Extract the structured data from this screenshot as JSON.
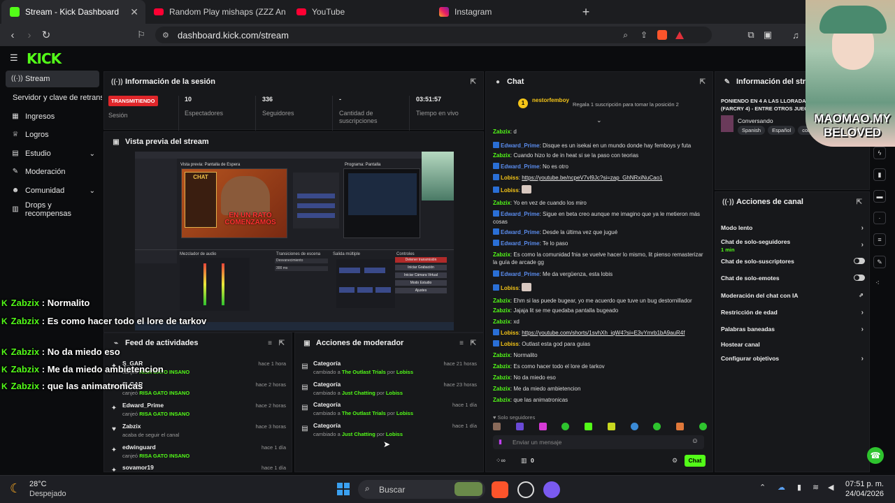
{
  "browser": {
    "tabs": [
      {
        "title": "Stream - Kick Dashboard",
        "active": true
      },
      {
        "title": "Random Play mishaps (ZZZ Animatio"
      },
      {
        "title": "YouTube"
      },
      {
        "title": "Instagram"
      }
    ],
    "url": "dashboard.kick.com/stream"
  },
  "brand": {
    "logo": "KICK",
    "accent": "#53fc18"
  },
  "sidebar": {
    "items": [
      {
        "label": "Stream",
        "icon": "signal-icon"
      },
      {
        "label": "Servidor y clave de retransmi",
        "icon": ""
      },
      {
        "label": "Ingresos",
        "icon": "revenue-icon"
      },
      {
        "label": "Logros",
        "icon": "trophy-icon"
      },
      {
        "label": "Estudio",
        "icon": "studio-icon"
      },
      {
        "label": "Moderación",
        "icon": "wrench-icon"
      },
      {
        "label": "Comunidad",
        "icon": "community-icon"
      },
      {
        "label": "Drops y recompensas",
        "icon": "gift-icon"
      }
    ]
  },
  "session": {
    "title": "Información de la sesión",
    "live_badge": "TRANSMITIENDO",
    "stats": [
      {
        "value": "",
        "label": "Sesión"
      },
      {
        "value": "10",
        "label": "Espectadores"
      },
      {
        "value": "336",
        "label": "Seguidores"
      },
      {
        "value": "-",
        "label": "Cantidad de suscripciones"
      },
      {
        "value": "03:51:57",
        "label": "Tiempo en vivo"
      }
    ]
  },
  "preview": {
    "title": "Vista previa del stream",
    "inner_left": "Vista previa: Pantalla de Espera",
    "inner_right": "Programa: Pantalla",
    "chat_label": "CHAT",
    "banner_text": "EN UN RATO COMENZAMOS",
    "mixer_label": "Mezclador de audio",
    "transitions_label": "Transiciones de escena",
    "exit_label": "Salida múltiple",
    "controls_label": "Controles",
    "controls": [
      "Detener transmisión",
      "Iniciar Grabación",
      "Iniciar Cámara Virtual",
      "Modo Estudio",
      "Ajustes"
    ],
    "transition_value": "Desvanecimiento",
    "duration_value": "300 ms"
  },
  "feed": {
    "title": "Feed de actividades",
    "items": [
      {
        "name": "S_GAR",
        "sub": "canjeó",
        "reward": "RISA GATO INSANO",
        "time": "hace 1 hora"
      },
      {
        "name": "S_GAR",
        "sub": "canjeó",
        "reward": "RISA GATO INSANO",
        "time": "hace 2 horas"
      },
      {
        "name": "Edward_Prime",
        "sub": "canjeó",
        "reward": "RISA GATO INSANO",
        "time": "hace 2 horas"
      },
      {
        "name": "Zabzix",
        "sub": "acaba de seguir el canal",
        "reward": "",
        "time": "hace 3 horas"
      },
      {
        "name": "edwinguard",
        "sub": "canjeó",
        "reward": "RISA GATO INSANO",
        "time": "hace 1 día"
      },
      {
        "name": "sovamor19",
        "sub": "",
        "reward": "",
        "time": "hace 1 día"
      }
    ]
  },
  "modactions": {
    "title": "Acciones de moderador",
    "items": [
      {
        "name": "Categoría",
        "pre": "cambiado a",
        "val": "The Outlast Trials",
        "by": "por",
        "who": "Lobiss",
        "time": "hace 21 horas"
      },
      {
        "name": "Categoría",
        "pre": "cambiado a",
        "val": "Just Chatting",
        "by": "por",
        "who": "Lobiss",
        "time": "hace 23 horas"
      },
      {
        "name": "Categoría",
        "pre": "cambiado a",
        "val": "The Outlast Trials",
        "by": "por",
        "who": "Lobiss",
        "time": "hace 1 día"
      },
      {
        "name": "Categoría",
        "pre": "cambiado a",
        "val": "Just Chatting",
        "by": "por",
        "who": "Lobiss",
        "time": "hace 1 día"
      }
    ]
  },
  "chat": {
    "title": "Chat",
    "pinned_user": "nestorfemboy",
    "pinned_count": "1",
    "gift_text": "Regala 1 suscripción para tomar la posición 2",
    "messages": [
      {
        "user": "Zabzix",
        "text": "d",
        "color": "#53fc18",
        "badge": false
      },
      {
        "user": "Edward_Prime",
        "text": "Disque es un isekai en un mundo donde hay femboys y futa",
        "color": "#5b8def",
        "badge": true
      },
      {
        "user": "Zabzix",
        "text": "Cuando hizo lo de in heat si se la paso con teorias",
        "color": "#53fc18",
        "badge": false
      },
      {
        "user": "Edward_Prime",
        "text": "No es otro",
        "color": "#5b8def",
        "badge": true
      },
      {
        "user": "Lobiss",
        "text": "https://youtube.be/ncpeV7vI9Jc?si=zap_GhNRxiNuCao1",
        "color": "#f5c518",
        "badge": true,
        "link": true
      },
      {
        "user": "Lobiss",
        "text": "",
        "color": "#f5c518",
        "badge": true,
        "emote": true
      },
      {
        "user": "Zabzix",
        "text": "Yo en vez de cuando los miro",
        "color": "#53fc18",
        "badge": false
      },
      {
        "user": "Edward_Prime",
        "text": "Sigue en beta creo aunque me imagino que ya le metieron más cosas",
        "color": "#5b8def",
        "badge": true
      },
      {
        "user": "Edward_Prime",
        "text": "Desde la última vez que jugué",
        "color": "#5b8def",
        "badge": true
      },
      {
        "user": "Edward_Prime",
        "text": "Te lo paso",
        "color": "#5b8def",
        "badge": true
      },
      {
        "user": "Zabzix",
        "text": "Es como la comunidad fnia se vuelve hacer lo mismo, lit pienso remasterizar la guía de arcade gg",
        "color": "#53fc18",
        "badge": false
      },
      {
        "user": "Edward_Prime",
        "text": "Me da vergüenza, esta lobis",
        "color": "#5b8def",
        "badge": true
      },
      {
        "user": "Lobiss",
        "text": "",
        "color": "#f5c518",
        "badge": true,
        "emote": true
      },
      {
        "user": "Zabzix",
        "text": "Ehm si las puede bugear, yo me acuerdo que tuve un bug destornillador",
        "color": "#53fc18",
        "badge": false
      },
      {
        "user": "Zabzix",
        "text": "Jajaja lit se me quedaba pantalla bugeado",
        "color": "#53fc18",
        "badge": false
      },
      {
        "user": "Zabzix",
        "text": "xd",
        "color": "#53fc18",
        "badge": false
      },
      {
        "user": "Lobiss",
        "text": "https://youtube.com/shorts/1svhXh_iqW4?si=E3vYmrb1bA9auR4f",
        "color": "#f5c518",
        "badge": true,
        "link": true
      },
      {
        "user": "Lobiss",
        "text": "Outlast esta god para guias",
        "color": "#f5c518",
        "badge": true
      },
      {
        "user": "Zabzix",
        "text": "Normalito",
        "color": "#53fc18",
        "badge": false
      },
      {
        "user": "Zabzix",
        "text": "Es como hacer todo el lore de tarkov",
        "color": "#53fc18",
        "badge": false
      },
      {
        "user": "Zabzix",
        "text": "No da miedo eso",
        "color": "#53fc18",
        "badge": false
      },
      {
        "user": "Zabzix",
        "text": "Me da miedo ambietencion",
        "color": "#53fc18",
        "badge": false
      },
      {
        "user": "Zabzix",
        "text": "que las animatronicas",
        "color": "#53fc18",
        "badge": false
      }
    ],
    "followers_only": "Solo seguidores",
    "input_placeholder": "Enviar un mensaje",
    "count": "0",
    "send_label": "Chat"
  },
  "info": {
    "title": "Información del stream",
    "stream_title": "PONIENDO EN 4 A LAS LLORADAS (FARCRY 4) - ENTRE OTROS JUEGOS",
    "category": "Conversando",
    "tags": [
      "Spanish",
      "Español",
      "conversando"
    ]
  },
  "channel_actions": {
    "title": "Acciones de canal",
    "items": [
      {
        "label": "Modo lento",
        "sub": "",
        "kind": "arrow"
      },
      {
        "label": "Chat de solo-seguidores",
        "sub": "1 min",
        "kind": "arrow"
      },
      {
        "label": "Chat de solo-suscriptores",
        "sub": "",
        "kind": "toggle"
      },
      {
        "label": "Chat de solo-emotes",
        "sub": "",
        "kind": "toggle"
      },
      {
        "label": "Moderación del chat con IA",
        "sub": "",
        "kind": "ext"
      },
      {
        "label": "Restricción de edad",
        "sub": "",
        "kind": "arrow"
      },
      {
        "label": "Palabras baneadas",
        "sub": "",
        "kind": "arrow"
      },
      {
        "label": "Hostear canal",
        "sub": "",
        "kind": "none"
      },
      {
        "label": "Configurar objetivos",
        "sub": "",
        "kind": "arrow"
      }
    ]
  },
  "overlay": {
    "watermark": "MAOMAO.MY BELOVED",
    "lines": [
      {
        "user": "Zabzix",
        "text": "Normalito"
      },
      {
        "user": "Zabzix",
        "text": "Es como hacer todo el lore de tarkov"
      },
      {
        "user": "Zabzix",
        "text": "No da miedo eso"
      },
      {
        "user": "Zabzix",
        "text": "Me da miedo ambietencion"
      },
      {
        "user": "Zabzix",
        "text": "que las animatronicas"
      }
    ]
  },
  "taskbar": {
    "weather_temp": "28°C",
    "weather_desc": "Despejado",
    "search_label": "Buscar",
    "time": "07:51 p. m.",
    "date": "24/04/2026"
  }
}
